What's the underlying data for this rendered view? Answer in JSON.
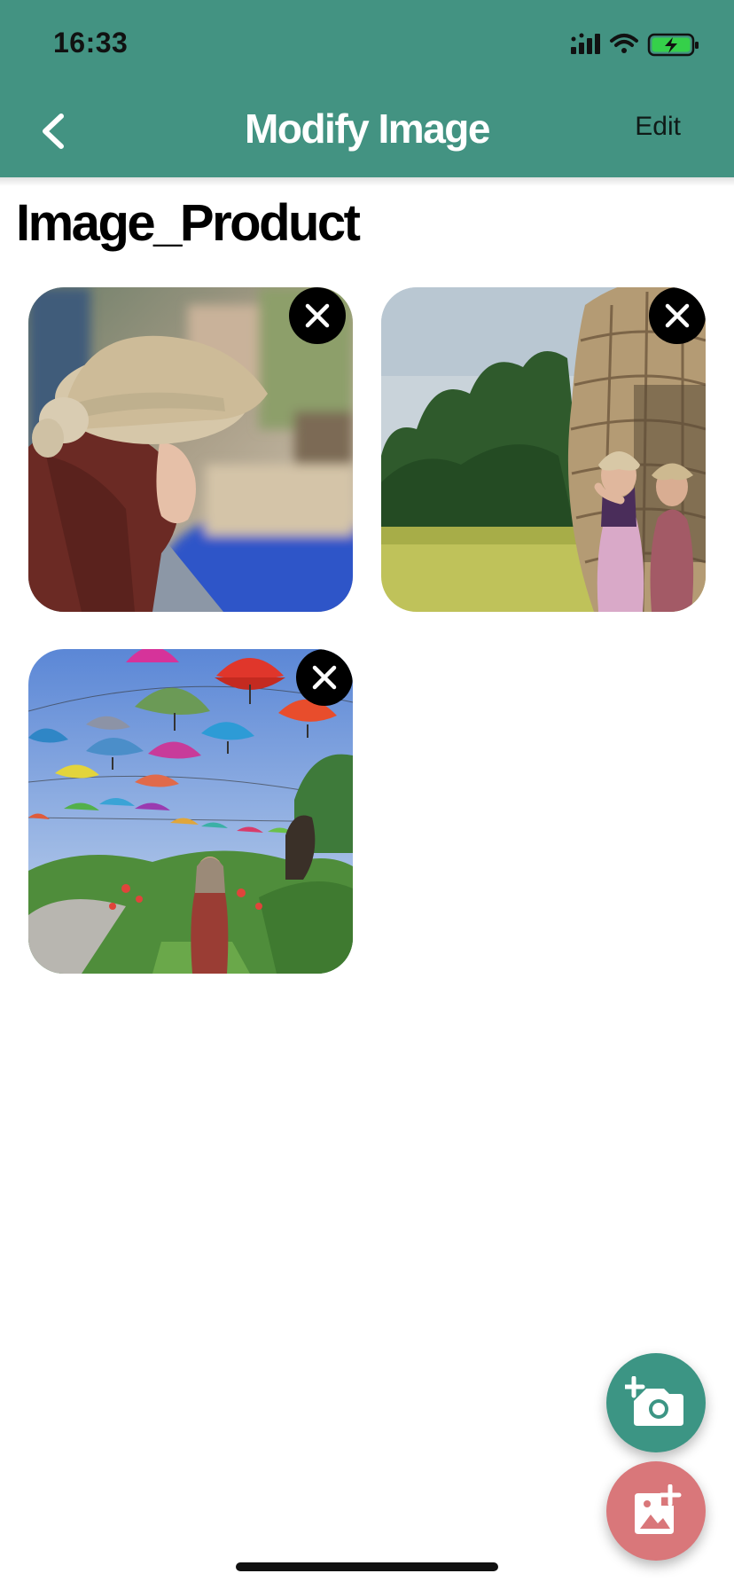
{
  "status_bar": {
    "time": "16:33",
    "icons": [
      "cellular-signal-icon",
      "wifi-icon",
      "battery-charging-icon"
    ]
  },
  "nav": {
    "back_icon": "chevron-left-icon",
    "title": "Modify Image",
    "edit_label": "Edit"
  },
  "section": {
    "title": "Image_Product"
  },
  "images": [
    {
      "subject": "woman-with-hat-photo",
      "remove_icon": "close-icon"
    },
    {
      "subject": "rice-field-selfie-photo",
      "remove_icon": "close-icon"
    },
    {
      "subject": "umbrella-garden-photo",
      "remove_icon": "close-icon"
    }
  ],
  "fabs": {
    "camera_icon": "add-camera-icon",
    "gallery_icon": "add-image-icon"
  },
  "colors": {
    "header": "#439382",
    "fab_camera": "#3c9584",
    "fab_gallery": "#d9777a",
    "remove_button": "#000000"
  }
}
